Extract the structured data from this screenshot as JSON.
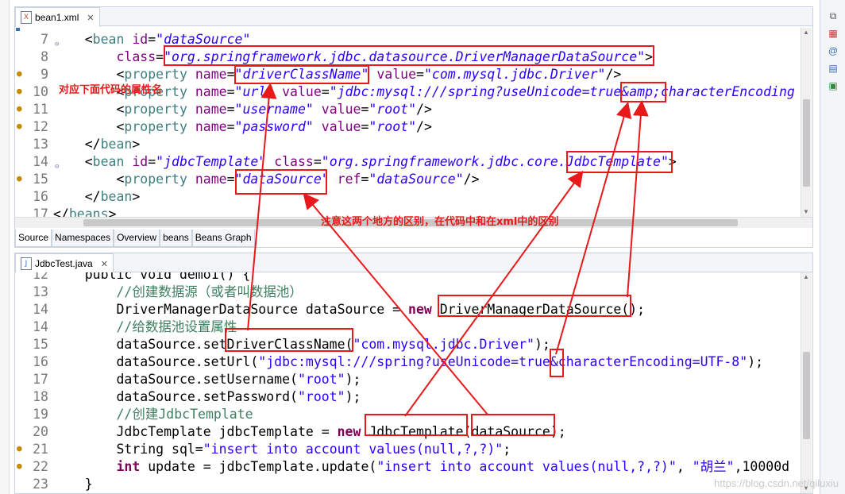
{
  "top_tab": {
    "label": "bean1.xml",
    "close": "✕"
  },
  "bottom_tab": {
    "label": "JdbcTest.java",
    "close": "✕"
  },
  "source_tabs": [
    "Source",
    "Namespaces",
    "Overview",
    "beans",
    "Beans Graph"
  ],
  "annotations": {
    "prop_name": "对应下面代码的属性名",
    "difference": "注意这两个地方的区别，在代码中和在xml中的区别"
  },
  "watermark": "https://blog.csdn.net/qiluxiu",
  "colors": {
    "annotation_red": "#e8191a",
    "line_number": "#787878",
    "xml_tag": "#3f7f7f",
    "xml_attr": "#7f007f",
    "xml_value": "#2a00ff",
    "java_keyword": "#7f0055",
    "java_comment": "#3f7f5f"
  },
  "xml_lines": [
    {
      "num": "7",
      "tokens": [
        [
          "p",
          "    <"
        ],
        [
          "tag",
          "bean"
        ],
        [
          "p",
          " "
        ],
        [
          "attr",
          "id"
        ],
        [
          "p",
          "="
        ],
        [
          "val",
          "\"dataSource\""
        ]
      ]
    },
    {
      "num": "8",
      "tokens": [
        [
          "p",
          "        "
        ],
        [
          "attr",
          "class"
        ],
        [
          "p",
          "="
        ],
        [
          "val",
          "\"org.springframework.jdbc.datasource.DriverManagerDataSource\""
        ],
        [
          "p",
          ">"
        ]
      ]
    },
    {
      "num": "9",
      "tokens": [
        [
          "p",
          "        <"
        ],
        [
          "tag",
          "property"
        ],
        [
          "p",
          " "
        ],
        [
          "attr",
          "name"
        ],
        [
          "p",
          "="
        ],
        [
          "val",
          "\"driverClassName\""
        ],
        [
          "p",
          " "
        ],
        [
          "attr",
          "value"
        ],
        [
          "p",
          "="
        ],
        [
          "val",
          "\"com.mysql.jdbc.Driver\""
        ],
        [
          "p",
          "/>"
        ]
      ]
    },
    {
      "num": "10",
      "tokens": [
        [
          "p",
          "        <"
        ],
        [
          "tag",
          "property"
        ],
        [
          "p",
          " "
        ],
        [
          "attr",
          "name"
        ],
        [
          "p",
          "="
        ],
        [
          "val",
          "\"url\""
        ],
        [
          "p",
          " "
        ],
        [
          "attr",
          "value"
        ],
        [
          "p",
          "="
        ],
        [
          "val",
          "\"jdbc:mysql:///spring?useUnicode=true&amp;characterEncoding"
        ]
      ]
    },
    {
      "num": "11",
      "tokens": [
        [
          "p",
          "        <"
        ],
        [
          "tag",
          "property"
        ],
        [
          "p",
          " "
        ],
        [
          "attr",
          "name"
        ],
        [
          "p",
          "="
        ],
        [
          "val",
          "\"username\""
        ],
        [
          "p",
          " "
        ],
        [
          "attr",
          "value"
        ],
        [
          "p",
          "="
        ],
        [
          "val",
          "\"root\""
        ],
        [
          "p",
          "/>"
        ]
      ]
    },
    {
      "num": "12",
      "tokens": [
        [
          "p",
          "        <"
        ],
        [
          "tag",
          "property"
        ],
        [
          "p",
          " "
        ],
        [
          "attr",
          "name"
        ],
        [
          "p",
          "="
        ],
        [
          "val",
          "\"password\""
        ],
        [
          "p",
          " "
        ],
        [
          "attr",
          "value"
        ],
        [
          "p",
          "="
        ],
        [
          "val",
          "\"root\""
        ],
        [
          "p",
          "/>"
        ]
      ]
    },
    {
      "num": "13",
      "tokens": [
        [
          "p",
          "    </"
        ],
        [
          "tag",
          "bean"
        ],
        [
          "p",
          ">"
        ]
      ]
    },
    {
      "num": "14",
      "tokens": [
        [
          "p",
          "    <"
        ],
        [
          "tag",
          "bean"
        ],
        [
          "p",
          " "
        ],
        [
          "attr",
          "id"
        ],
        [
          "p",
          "="
        ],
        [
          "val",
          "\"jdbcTemplate\""
        ],
        [
          "p",
          " "
        ],
        [
          "attr",
          "class"
        ],
        [
          "p",
          "="
        ],
        [
          "val",
          "\"org.springframework.jdbc.core.JdbcTemplate\""
        ],
        [
          "p",
          ">"
        ]
      ]
    },
    {
      "num": "15",
      "tokens": [
        [
          "p",
          "        <"
        ],
        [
          "tag",
          "property"
        ],
        [
          "p",
          " "
        ],
        [
          "attr",
          "name"
        ],
        [
          "p",
          "="
        ],
        [
          "val",
          "\"dataSource\""
        ],
        [
          "p",
          " "
        ],
        [
          "attr",
          "ref"
        ],
        [
          "p",
          "="
        ],
        [
          "val",
          "\"dataSource\""
        ],
        [
          "p",
          "/>"
        ]
      ]
    },
    {
      "num": "16",
      "tokens": [
        [
          "p",
          "    </"
        ],
        [
          "tag",
          "bean"
        ],
        [
          "p",
          ">"
        ]
      ]
    },
    {
      "num": "17",
      "tokens": [
        [
          "p",
          "</"
        ],
        [
          "tag",
          "beans"
        ],
        [
          "p",
          ">"
        ]
      ]
    }
  ],
  "java_lines": [
    {
      "num": "12",
      "tokens": [
        [
          "p",
          "    public void demo1() {"
        ]
      ]
    },
    {
      "num": "13",
      "tokens": [
        [
          "p",
          "        "
        ],
        [
          "com",
          "//创建数据源（或者叫数据池）"
        ]
      ]
    },
    {
      "num": "14",
      "tokens": [
        [
          "p",
          "        DriverManagerDataSource dataSource = "
        ],
        [
          "kw",
          "new"
        ],
        [
          "p",
          " DriverManagerDataSource();"
        ]
      ]
    },
    {
      "num": "14",
      "tokens": [
        [
          "p",
          "        "
        ],
        [
          "com",
          "//给数据池设置属性"
        ]
      ]
    },
    {
      "num": "15",
      "tokens": [
        [
          "p",
          "        dataSource.setDriverClassName("
        ],
        [
          "str",
          "\"com.mysql.jdbc.Driver\""
        ],
        [
          "p",
          ");"
        ]
      ]
    },
    {
      "num": "16",
      "tokens": [
        [
          "p",
          "        dataSource.setUrl("
        ],
        [
          "str",
          "\"jdbc:mysql:///spring?useUnicode=true&characterEncoding=UTF-8\""
        ],
        [
          "p",
          ");"
        ]
      ]
    },
    {
      "num": "17",
      "tokens": [
        [
          "p",
          "        dataSource.setUsername("
        ],
        [
          "str",
          "\"root\""
        ],
        [
          "p",
          ");"
        ]
      ]
    },
    {
      "num": "18",
      "tokens": [
        [
          "p",
          "        dataSource.setPassword("
        ],
        [
          "str",
          "\"root\""
        ],
        [
          "p",
          ");"
        ]
      ]
    },
    {
      "num": "19",
      "tokens": [
        [
          "p",
          "        "
        ],
        [
          "com",
          "//创建JdbcTemplate"
        ]
      ]
    },
    {
      "num": "20",
      "tokens": [
        [
          "p",
          "        JdbcTemplate jdbcTemplate = "
        ],
        [
          "kw",
          "new"
        ],
        [
          "p",
          " JdbcTemplate(dataSource);"
        ]
      ]
    },
    {
      "num": "21",
      "tokens": [
        [
          "p",
          "        String sql="
        ],
        [
          "str",
          "\"insert into account values(null,?,?)\""
        ],
        [
          "p",
          ";"
        ]
      ]
    },
    {
      "num": "22",
      "tokens": [
        [
          "p",
          "        "
        ],
        [
          "kw",
          "int"
        ],
        [
          "p",
          " update = jdbcTemplate.update("
        ],
        [
          "str",
          "\"insert into account values(null,?,?)\""
        ],
        [
          "p",
          ", "
        ],
        [
          "str",
          "\"胡兰\""
        ],
        [
          "p",
          ",10000d"
        ]
      ]
    },
    {
      "num": "23",
      "tokens": [
        [
          "p",
          "    }"
        ]
      ]
    }
  ]
}
